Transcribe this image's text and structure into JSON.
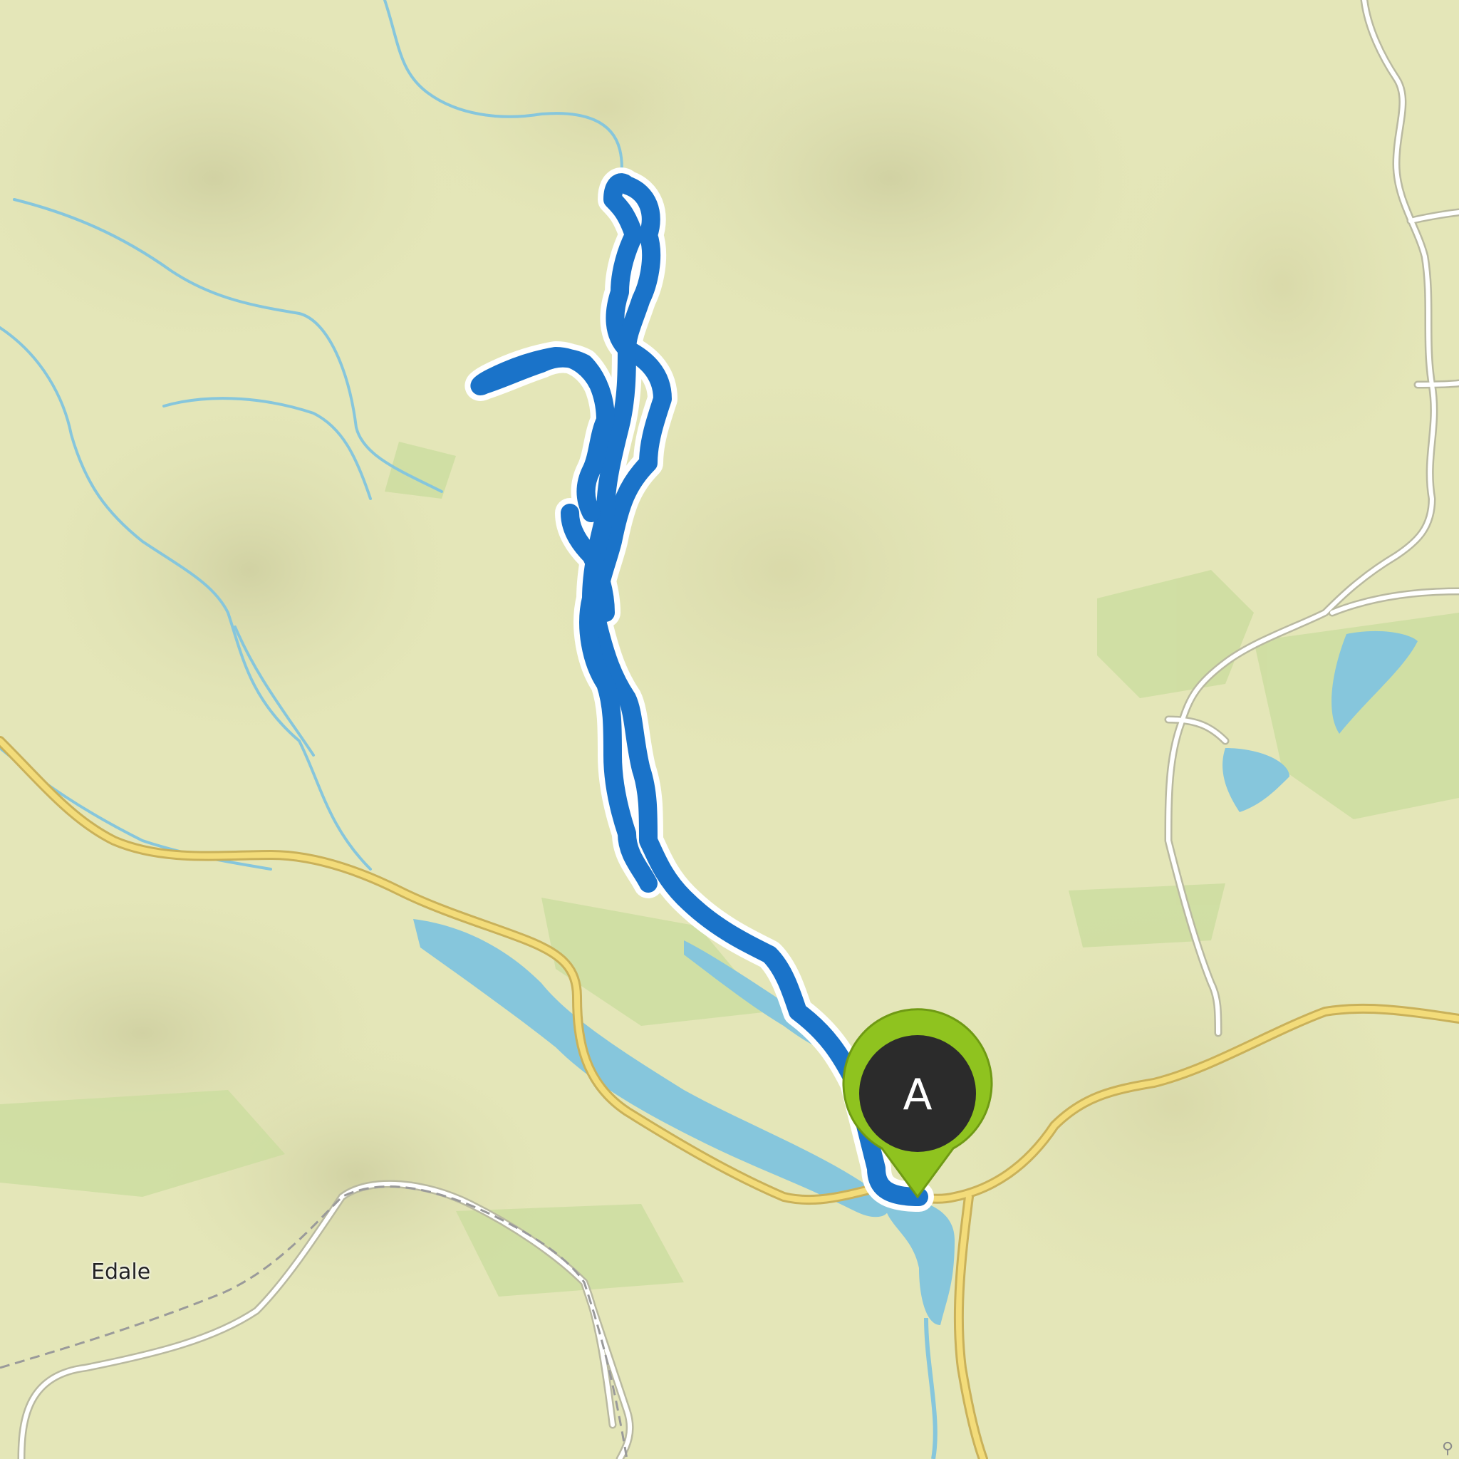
{
  "map": {
    "place_labels": [
      {
        "name": "Edale"
      }
    ],
    "start_marker": {
      "label": "A",
      "color": "#8fc31f"
    },
    "route": {
      "color": "#1a73c9",
      "outline": "#ffffff"
    },
    "colors": {
      "terrain": "#e4e6b8",
      "woodland": "#cddda0",
      "water": "#86c6dc",
      "main_road": "#f3dc7a",
      "minor_road": "#ffffff",
      "railway": "#9a9a9a"
    }
  }
}
